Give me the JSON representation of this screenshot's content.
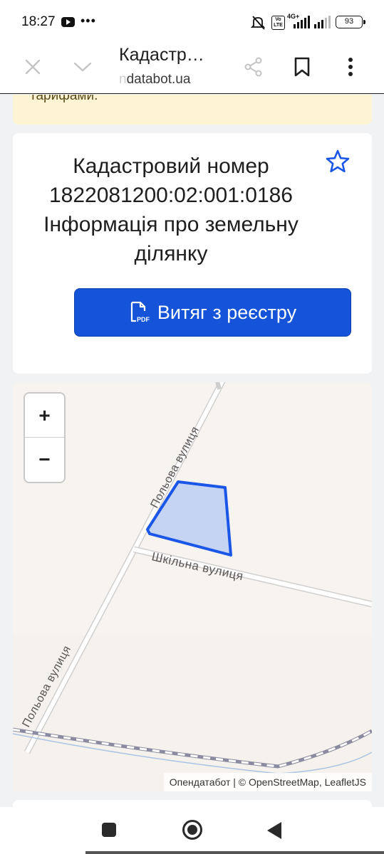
{
  "status_bar": {
    "time": "18:27",
    "network": "4G+",
    "volte": "Vo LTE",
    "battery": "93"
  },
  "toolbar": {
    "title": "Кадастр…",
    "url_prefix": "n",
    "url": "databot.ua"
  },
  "banner": {
    "text": "тарифами."
  },
  "card": {
    "heading_lines": [
      "Кадастровий номер",
      "1822081200:02:001:0186",
      "Інформація про земельну",
      "ділянку"
    ],
    "pdf_button_label": "Витяг з реєстру",
    "pdf_icon_text": "PDF"
  },
  "map": {
    "zoom_in_label": "+",
    "zoom_out_label": "−",
    "street_labels": [
      "Польова вулиця",
      "Шкільна вулиця",
      "Польова вулиця"
    ],
    "attribution": "Опендатабот | © OpenStreetMap, LeafletJS"
  },
  "colors": {
    "accent": "#1554d8",
    "parcel_stroke": "#1a56e8",
    "parcel_fill": "#c5d4f3",
    "banner_bg": "#fdf4d3"
  },
  "icons": {
    "close": "close-icon",
    "chevron": "chevron-down-icon",
    "share": "share-icon",
    "bookmark": "bookmark-icon",
    "menu": "more-vertical-icon",
    "star": "star-icon",
    "pdf": "pdf-file-icon"
  }
}
